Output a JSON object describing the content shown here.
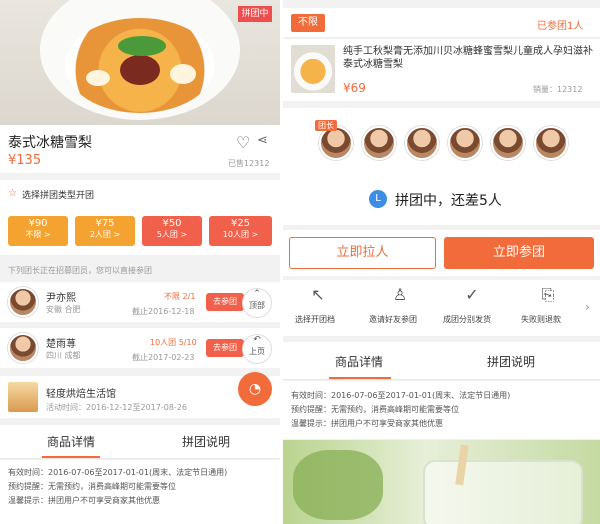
{
  "left": {
    "badge": "拼团中",
    "product": {
      "title": "泰式冰糖雪梨",
      "price": "¥135",
      "sold": "已售12312"
    },
    "group_type": {
      "title": "选择拼团类型开团",
      "options": [
        {
          "price": "¥90",
          "sub": "不限 >"
        },
        {
          "price": "¥75",
          "sub": "2人团 >"
        },
        {
          "price": "¥50",
          "sub": "5人团 >"
        },
        {
          "price": "¥25",
          "sub": "10人团 >"
        }
      ]
    },
    "join_hint": "下列团长正在招募团员，您可以直接参团",
    "leaders": [
      {
        "name": "尹亦熙",
        "location": "安徽 合肥",
        "status": "不限 2/1",
        "deadline": "截止2016-12-18",
        "btn": "去参团",
        "side": "顶部"
      },
      {
        "name": "楚雨荨",
        "location": "四川 成都",
        "status": "10人团 5/10",
        "deadline": "截止2017-02-23",
        "btn": "去参团",
        "side": "上页"
      }
    ],
    "shop": {
      "name": "轻度烘焙生活馆",
      "date_range": "活动时间：2016-12-12至2017-08-26"
    },
    "tabs": [
      "商品详情",
      "拼团说明"
    ],
    "details": [
      "有效时间：2016-07-06至2017-01-01(周末、法定节日通用)",
      "预约提醒：无需预约，消费高峰期可能需要等位",
      "温馨提示：拼团用户不可享受商家其他优惠"
    ]
  },
  "right": {
    "tag": "不限",
    "joined": "已参团1人",
    "product": {
      "title": "纯手工秋梨膏无添加川贝冰糖蜂蜜雪梨儿童成人孕妇滋补泰式冰糖雪梨",
      "price": "¥69",
      "sales": "销量：12312"
    },
    "leader_tag": "团长",
    "status_text": "拼团中，还差5人",
    "invite_btn": "立即拉人",
    "join_btn": "立即参团",
    "steps": [
      {
        "icon": "cursor-icon",
        "label": "选择开团档"
      },
      {
        "icon": "add-user-icon",
        "label": "邀请好友参团"
      },
      {
        "icon": "check-circle-icon",
        "label": "成团分别发货"
      },
      {
        "icon": "refund-icon",
        "label": "失败则退款"
      }
    ],
    "tabs": [
      "商品详情",
      "拼团说明"
    ],
    "details": [
      "有效时间：2016-07-06至2017-01-01(周末、法定节日通用)",
      "预约提醒：无需预约，消费高峰期可能需要等位",
      "温馨提示：拼团用户不可享受商家其他优惠"
    ]
  }
}
